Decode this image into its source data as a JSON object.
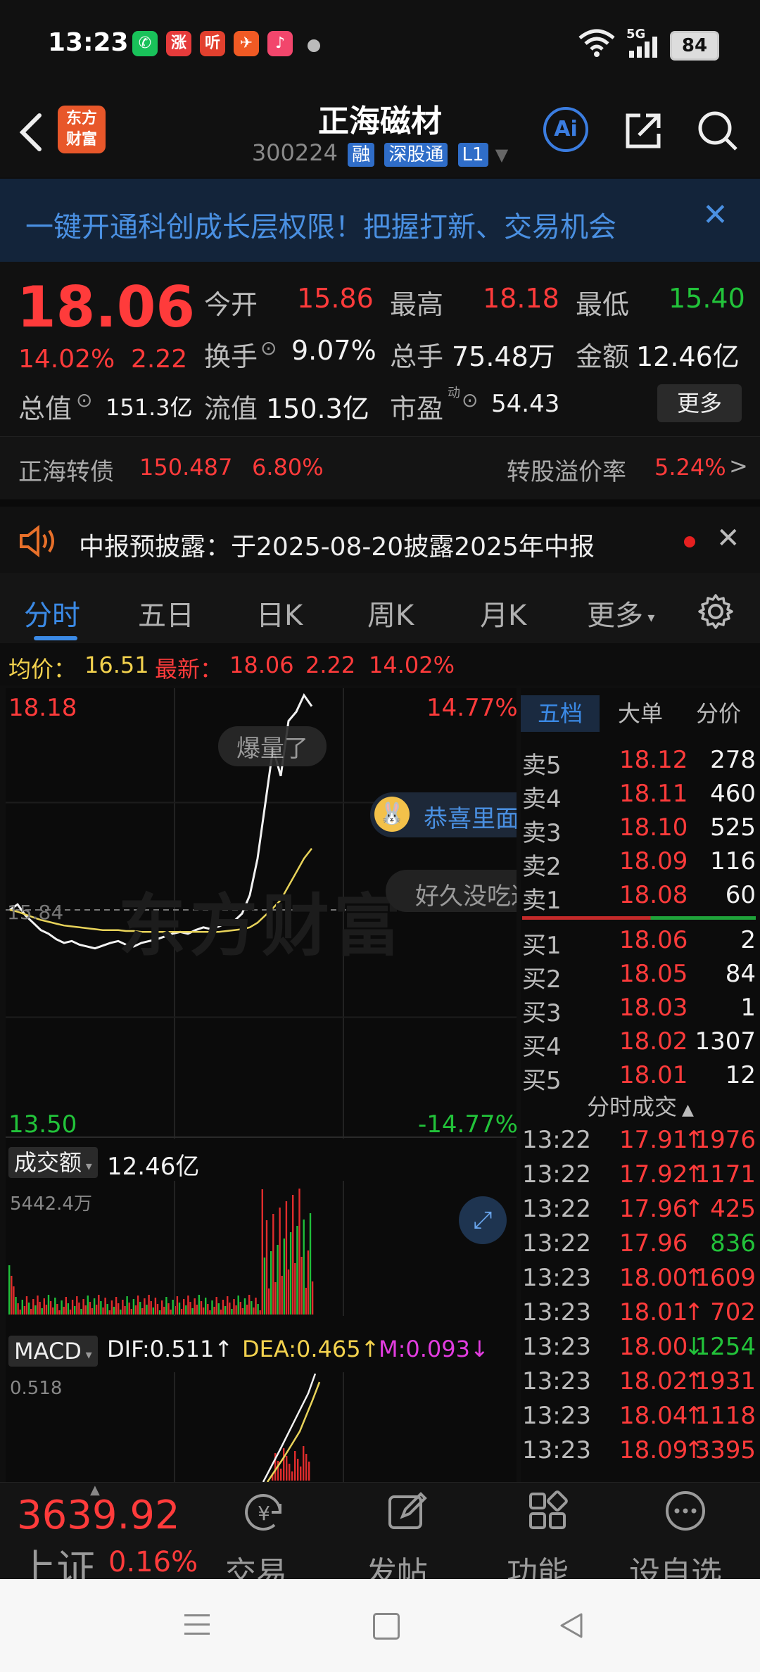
{
  "status": {
    "time": "13:23",
    "battery": "84",
    "network": "5G",
    "apps": [
      {
        "name": "wechat-icon",
        "color": "#19c25a",
        "glyph": "✆"
      },
      {
        "name": "zhang-app-icon",
        "color": "#e63b3b",
        "glyph": "涨"
      },
      {
        "name": "ting-app-icon",
        "color": "#e2402e",
        "glyph": "听"
      },
      {
        "name": "share-app-icon",
        "color": "#f05a24",
        "glyph": "✈"
      },
      {
        "name": "music-app-icon",
        "color": "#f2466c",
        "glyph": "♪"
      }
    ]
  },
  "header": {
    "logo_line1": "东方",
    "logo_line2": "财富",
    "title": "正海磁材",
    "code": "300224",
    "tags": [
      "融",
      "深股通",
      "L1"
    ],
    "ai_label": "Ai"
  },
  "banner": {
    "text": "一键开通科创成长层权限！把握打新、交易机会"
  },
  "quote": {
    "price": "18.06",
    "change_pct": "14.02%",
    "change": "2.22",
    "open_label": "今开",
    "open": "15.86",
    "high_label": "最高",
    "high": "18.18",
    "low_label": "最低",
    "low": "15.40",
    "turnover_label": "换手",
    "turnover": "9.07%",
    "volume_label": "总手",
    "volume": "75.48万",
    "amount_label": "金额",
    "amount": "12.46亿",
    "mcap_label": "总值",
    "mcap": "151.3亿",
    "float_label": "流值",
    "float": "150.3亿",
    "pe_label": "市盈",
    "pe_sup": "动",
    "pe": "54.43",
    "more_button": "更多"
  },
  "bond": {
    "name": "正海转债",
    "price": "150.487",
    "pct": "6.80%",
    "premium_label": "转股溢价率",
    "premium": "5.24%",
    "arrow": ">"
  },
  "notice": {
    "text": "中报预披露：于2025-08-20披露2025年中报"
  },
  "tabs": [
    "分时",
    "五日",
    "日K",
    "周K",
    "月K",
    "更多"
  ],
  "info_line": {
    "avg_label": "均价：",
    "avg": "16.51",
    "latest_label": "最新：",
    "latest": "18.06",
    "change": "2.22",
    "pct": "14.02%"
  },
  "chart_labels": {
    "top_price": "18.18",
    "top_pct": "14.77%",
    "bottom_price": "13.50",
    "bottom_pct": "-14.77%",
    "pre_close": "15.84",
    "watermark": "东方财富",
    "bubble1": "爆量了",
    "bubble2": "恭喜里面",
    "bubble3": "好久没吃过",
    "volume_selector": "成交额",
    "volume_total": "12.46亿",
    "volume_max": "5442.4万",
    "macd_selector": "MACD",
    "dif": "DIF:0.511",
    "dif_arrow": "↑",
    "dea": "DEA:0.465",
    "dea_arrow": "↑",
    "m": "M:0.093",
    "m_arrow": "↓",
    "macd_max": "0.518"
  },
  "chart_data": {
    "type": "line",
    "ylim": [
      13.5,
      18.18
    ],
    "pre_close": 15.84,
    "series": [
      {
        "values": [
          15.84,
          15.9,
          15.78,
          15.7,
          15.62,
          15.58,
          15.52,
          15.48,
          15.5,
          15.46,
          15.44,
          15.42,
          15.45,
          15.48,
          15.5,
          15.46,
          15.44,
          15.48,
          15.5,
          15.52,
          15.55,
          15.58,
          15.6,
          15.58,
          15.62,
          15.65,
          15.63,
          15.66,
          15.7,
          15.72,
          15.8,
          16.0,
          16.4,
          17.0,
          17.6,
          17.3,
          17.9,
          18.0,
          18.18,
          18.06
        ]
      },
      {
        "values": [
          15.84,
          15.82,
          15.79,
          15.76,
          15.73,
          15.71,
          15.69,
          15.67,
          15.66,
          15.65,
          15.64,
          15.63,
          15.62,
          15.62,
          15.62,
          15.61,
          15.61,
          15.6,
          15.6,
          15.6,
          15.6,
          15.6,
          15.6,
          15.6,
          15.6,
          15.6,
          15.6,
          15.6,
          15.61,
          15.62,
          15.63,
          15.65,
          15.7,
          15.78,
          15.86,
          15.95,
          16.1,
          16.25,
          16.4,
          16.51
        ]
      }
    ]
  },
  "book": {
    "tabs": [
      "五档",
      "大单",
      "分价"
    ],
    "asks": [
      {
        "label": "卖5",
        "price": "18.12",
        "vol": "278"
      },
      {
        "label": "卖4",
        "price": "18.11",
        "vol": "460"
      },
      {
        "label": "卖3",
        "price": "18.10",
        "vol": "525"
      },
      {
        "label": "卖2",
        "price": "18.09",
        "vol": "116"
      },
      {
        "label": "卖1",
        "price": "18.08",
        "vol": "60"
      }
    ],
    "bids": [
      {
        "label": "买1",
        "price": "18.06",
        "vol": "2"
      },
      {
        "label": "买2",
        "price": "18.05",
        "vol": "84"
      },
      {
        "label": "买3",
        "price": "18.03",
        "vol": "1"
      },
      {
        "label": "买4",
        "price": "18.02",
        "vol": "1307"
      },
      {
        "label": "买5",
        "price": "18.01",
        "vol": "12"
      }
    ],
    "trades_title": "分时成交",
    "trades": [
      {
        "time": "13:22",
        "price": "17.91",
        "arrow": "↑",
        "vol": "1976",
        "vcolor": "#ff3b3b",
        "acolor": "#ff3b3b"
      },
      {
        "time": "13:22",
        "price": "17.92",
        "arrow": "↑",
        "vol": "1171",
        "vcolor": "#ff3b3b",
        "acolor": "#ff3b3b"
      },
      {
        "time": "13:22",
        "price": "17.96",
        "arrow": "↑",
        "vol": "425",
        "vcolor": "#ff3b3b",
        "acolor": "#ff3b3b"
      },
      {
        "time": "13:22",
        "price": "17.96",
        "arrow": "",
        "vol": "836",
        "vcolor": "#22c33a",
        "acolor": "#ff3b3b"
      },
      {
        "time": "13:23",
        "price": "18.00",
        "arrow": "↑",
        "vol": "1609",
        "vcolor": "#ff3b3b",
        "acolor": "#ff3b3b"
      },
      {
        "time": "13:23",
        "price": "18.01",
        "arrow": "↑",
        "vol": "702",
        "vcolor": "#ff3b3b",
        "acolor": "#ff3b3b"
      },
      {
        "time": "13:23",
        "price": "18.00",
        "arrow": "↓",
        "vol": "1254",
        "vcolor": "#22c33a",
        "acolor": "#22c33a"
      },
      {
        "time": "13:23",
        "price": "18.02",
        "arrow": "↑",
        "vol": "1931",
        "vcolor": "#ff3b3b",
        "acolor": "#ff3b3b"
      },
      {
        "time": "13:23",
        "price": "18.04",
        "arrow": "↑",
        "vol": "1118",
        "vcolor": "#ff3b3b",
        "acolor": "#ff3b3b"
      },
      {
        "time": "13:23",
        "price": "18.09",
        "arrow": "↑",
        "vol": "3395",
        "vcolor": "#ff3b3b",
        "acolor": "#ff3b3b"
      }
    ]
  },
  "bottom": {
    "index_value": "3639.92",
    "index_name": "上证",
    "index_pct": "0.16%",
    "items": [
      "交易",
      "发帖",
      "功能",
      "设自选"
    ]
  },
  "colors": {
    "up": "#ff3b3b",
    "down": "#22c33a",
    "accent": "#4a90e2"
  }
}
